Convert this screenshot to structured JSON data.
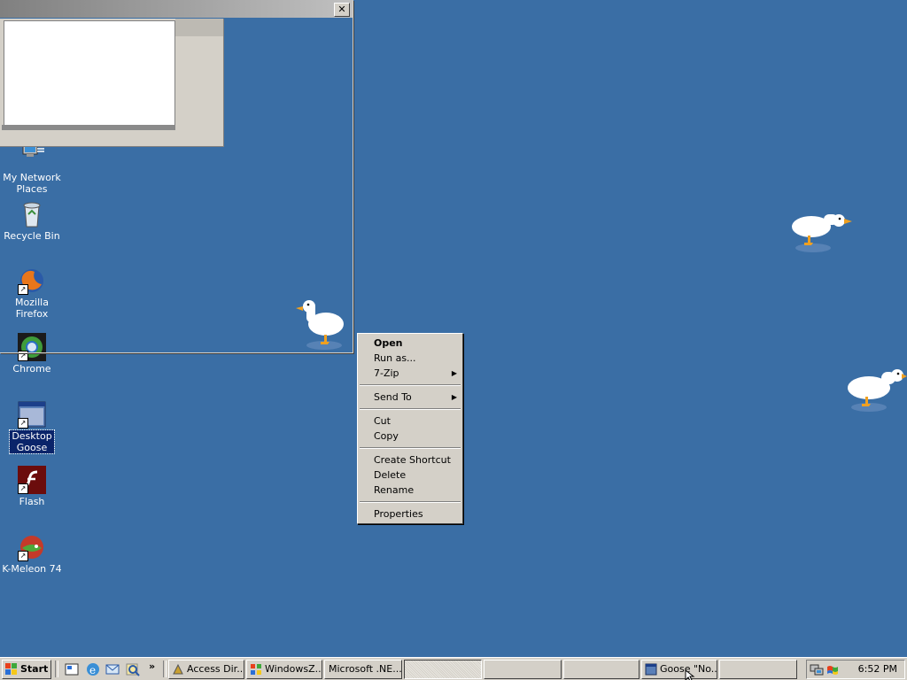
{
  "desktop": {
    "background": "#3a6ea5",
    "icons": [
      {
        "label_lines": [
          "My Network",
          "Places"
        ],
        "icon": "network-places-icon"
      },
      {
        "label_lines": [
          "Recycle Bin"
        ],
        "icon": "recycle-bin-icon"
      },
      {
        "label_lines": [
          "Mozilla Firefox"
        ],
        "icon": "firefox-icon"
      },
      {
        "label_lines": [
          "Chrome"
        ],
        "icon": "chrome-icon"
      },
      {
        "label_lines": [
          "Desktop",
          "Goose"
        ],
        "icon": "desktop-goose-icon",
        "selected": true
      },
      {
        "label_lines": [
          "Flash"
        ],
        "icon": "flash-icon"
      },
      {
        "label_lines": [
          "K-Meleon 74"
        ],
        "icon": "kmeleon-icon"
      }
    ]
  },
  "window": {
    "close_label": "✕"
  },
  "context_menu": {
    "items": [
      {
        "label": "Open",
        "bold": true
      },
      {
        "label": "Run as..."
      },
      {
        "label": "7-Zip",
        "submenu": true
      },
      {
        "separator": true
      },
      {
        "label": "Send To",
        "submenu": true
      },
      {
        "separator": true
      },
      {
        "label": "Cut"
      },
      {
        "label": "Copy"
      },
      {
        "separator": true
      },
      {
        "label": "Create Shortcut"
      },
      {
        "label": "Delete"
      },
      {
        "label": "Rename"
      },
      {
        "separator": true
      },
      {
        "label": "Properties"
      }
    ]
  },
  "taskbar": {
    "start_label": "Start",
    "quick_launch_more": "»",
    "tasks": [
      {
        "label": "Access Dir...",
        "icon": "access-dir-icon"
      },
      {
        "label": "WindowsZ...",
        "icon": "windowsz-icon"
      },
      {
        "label": "Microsoft .NE...",
        "icon": ""
      },
      {
        "label": "",
        "pressed": true
      },
      {
        "label": ""
      },
      {
        "label": ""
      },
      {
        "label": "Goose \"No...",
        "icon": "goose-task-icon"
      },
      {
        "label": ""
      }
    ],
    "clock": "6:52 PM"
  }
}
